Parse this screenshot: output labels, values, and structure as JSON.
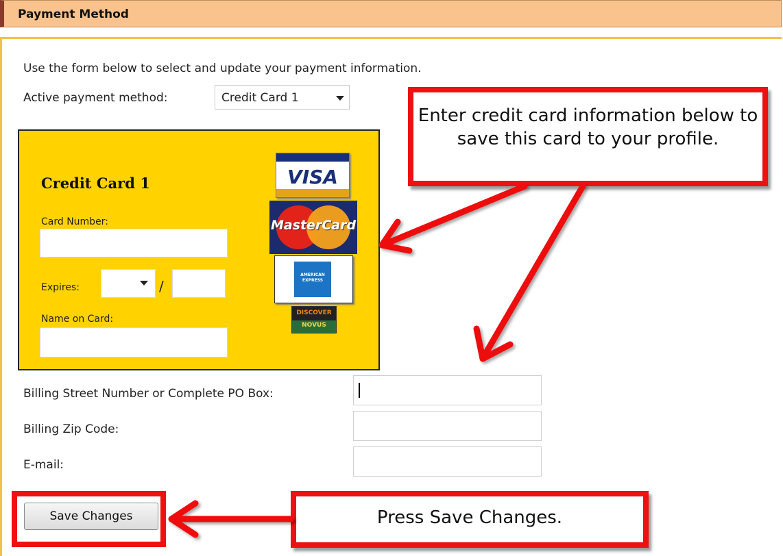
{
  "header": {
    "title": "Payment Method"
  },
  "intro_text": "Use the form below to select and update your payment information.",
  "active_method": {
    "label": "Active payment method:",
    "selected": "Credit Card 1"
  },
  "card": {
    "title": "Credit Card 1",
    "card_number_label": "Card Number:",
    "expires_label": "Expires:",
    "expires_separator": "/",
    "name_label": "Name on Card:",
    "logos": {
      "visa": "VISA",
      "mastercard": "MasterCard",
      "amex": "AMERICAN EXPRESS",
      "discover_top": "DISCOVER",
      "discover_bottom": "NOVUS"
    }
  },
  "billing": {
    "street_label": "Billing Street Number or Complete PO Box:",
    "zip_label": "Billing Zip Code:",
    "email_label": "E-mail:"
  },
  "save_button_label": "Save Changes",
  "callouts": {
    "card_info": "Enter credit card information below to save this card to your profile.",
    "save": "Press Save Changes."
  },
  "colors": {
    "header_bg": "#fac28c",
    "card_bg": "#ffd200",
    "callout_red": "#ee1111"
  }
}
